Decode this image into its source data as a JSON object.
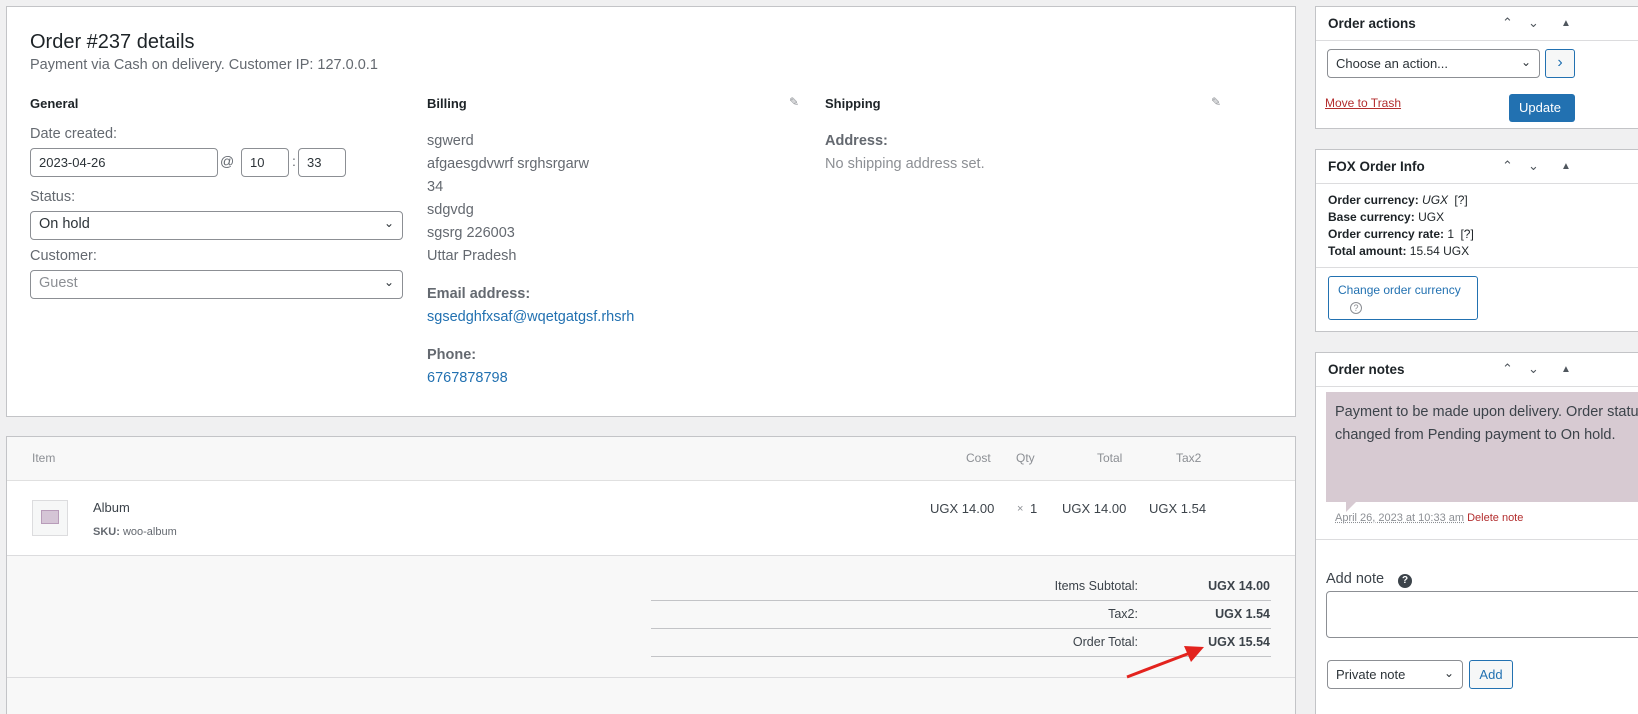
{
  "order": {
    "title": "Order #237 details",
    "subtitle": "Payment via Cash on delivery. Customer IP: 127.0.0.1",
    "general": {
      "heading": "General",
      "date_label": "Date created:",
      "date_value": "2023-04-26",
      "at_sign": "@",
      "hour": "10",
      "colon": ":",
      "minute": "33",
      "status_label": "Status:",
      "status_value": "On hold",
      "customer_label": "Customer:",
      "customer_value": "Guest"
    },
    "billing": {
      "heading": "Billing",
      "lines": [
        "sgwerd",
        "afgaesgdvwrf srghsrgarw",
        "34",
        "sdgvdg",
        "sgsrg 226003",
        "Uttar Pradesh"
      ],
      "email_label": "Email address:",
      "email": "sgsedghfxsaf@wqetgatgsf.rhsrh",
      "phone_label": "Phone:",
      "phone": "6767878798"
    },
    "shipping": {
      "heading": "Shipping",
      "address_label": "Address:",
      "address_value": "No shipping address set."
    }
  },
  "items": {
    "headers": {
      "item": "Item",
      "cost": "Cost",
      "qty": "Qty",
      "total": "Total",
      "tax": "Tax2"
    },
    "rows": [
      {
        "name": "Album",
        "sku_label": "SKU:",
        "sku": "woo-album",
        "cost": "UGX 14.00",
        "qty_x": "×",
        "qty": "1",
        "total": "UGX 14.00",
        "tax": "UGX 1.54"
      }
    ],
    "totals": [
      {
        "label": "Items Subtotal:",
        "value": "UGX 14.00"
      },
      {
        "label": "Tax2:",
        "value": "UGX 1.54"
      },
      {
        "label": "Order Total:",
        "value": "UGX 15.54"
      }
    ]
  },
  "sidebar": {
    "order_actions": {
      "title": "Order actions",
      "select_value": "Choose an action...",
      "go_label": "›",
      "trash_label": "Move to Trash",
      "update_label": "Update"
    },
    "fox_info": {
      "title": "FOX Order Info",
      "currency_label": "Order currency:",
      "currency_value": "UGX",
      "currency_help": "[?]",
      "base_label": "Base currency:",
      "base_value": "UGX",
      "rate_label": "Order currency rate:",
      "rate_value": "1",
      "rate_help": "[?]",
      "total_label": "Total amount:",
      "total_value": "15.54 UGX",
      "change_label": "Change order currency",
      "change_help": "?"
    },
    "order_notes": {
      "title": "Order notes",
      "note_text": "Payment to be made upon delivery. Order status changed from Pending payment to On hold.",
      "note_date": "April 26, 2023 at 10:33 am",
      "delete_label": "Delete note",
      "add_label": "Add note",
      "add_help": "?",
      "type_value": "Private note",
      "add_button": "Add"
    }
  },
  "colors": {
    "accent": "#2271b1",
    "danger": "#b32d2e",
    "note_bg": "#d7cad2",
    "arrow": "#e3231e"
  }
}
